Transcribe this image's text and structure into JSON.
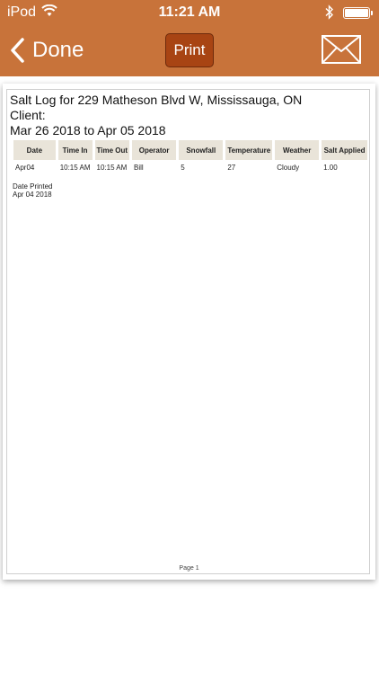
{
  "status": {
    "carrier": "iPod",
    "time": "11:21 AM",
    "icons": [
      "wifi-icon",
      "bluetooth-icon",
      "battery-icon"
    ]
  },
  "nav": {
    "back_label": "Done",
    "print_label": "Print",
    "mail_icon": "envelope-icon",
    "accent_color": "#c8733a",
    "print_button_color": "#a84413"
  },
  "report": {
    "title": "Salt Log for 229 Matheson Blvd W, Mississauga, ON",
    "client_label": "Client:",
    "date_range": "Mar 26 2018 to Apr 05 2018",
    "columns": [
      "Date",
      "Time In",
      "Time Out",
      "Operator",
      "Snowfall",
      "Temperature",
      "Weather",
      "Salt Applied"
    ],
    "rows": [
      [
        "Apr04",
        "10:15 AM",
        "10:15 AM",
        "Bill",
        "5",
        "27",
        "Cloudy",
        "1.00"
      ]
    ],
    "date_printed_label": "Date Printed",
    "date_printed_value": "Apr 04 2018",
    "page_label": "Page 1"
  }
}
